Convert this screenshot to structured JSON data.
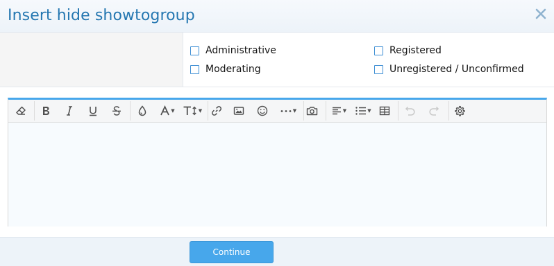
{
  "dialog": {
    "title": "Insert hide showtogroup",
    "close_icon": "close-icon"
  },
  "groups": [
    {
      "label": "Administrative",
      "checked": false
    },
    {
      "label": "Registered",
      "checked": false
    },
    {
      "label": "Moderating",
      "checked": false
    },
    {
      "label": "Unregistered / Unconfirmed",
      "checked": false
    }
  ],
  "toolbar": {
    "buttons": [
      {
        "icon": "eraser-icon",
        "title": "Remove formatting"
      },
      {
        "icon": "bold-icon",
        "title": "Bold"
      },
      {
        "icon": "italic-icon",
        "title": "Italic"
      },
      {
        "icon": "underline-icon",
        "title": "Underline"
      },
      {
        "icon": "strikethrough-icon",
        "title": "Strike-through"
      },
      {
        "icon": "text-color-icon",
        "title": "Text color"
      },
      {
        "icon": "font-family-icon",
        "title": "Font family"
      },
      {
        "icon": "font-size-icon",
        "title": "Font size"
      },
      {
        "icon": "link-icon",
        "title": "Insert link"
      },
      {
        "icon": "image-icon",
        "title": "Insert image"
      },
      {
        "icon": "smilie-icon",
        "title": "Smilies"
      },
      {
        "icon": "more-options-icon",
        "title": "More options"
      },
      {
        "icon": "camera-icon",
        "title": "Insert media"
      },
      {
        "icon": "align-icon",
        "title": "Alignment"
      },
      {
        "icon": "list-icon",
        "title": "List"
      },
      {
        "icon": "table-icon",
        "title": "Insert table"
      },
      {
        "icon": "undo-icon",
        "title": "Undo",
        "disabled": true
      },
      {
        "icon": "redo-icon",
        "title": "Redo",
        "disabled": true
      },
      {
        "icon": "settings-icon",
        "title": "Toggle BB code"
      }
    ]
  },
  "editor": {
    "content": ""
  },
  "footer": {
    "continue_label": "Continue"
  },
  "colors": {
    "accent": "#47a7eb",
    "title": "#2577b1",
    "checkbox": "#3d8ed4"
  }
}
